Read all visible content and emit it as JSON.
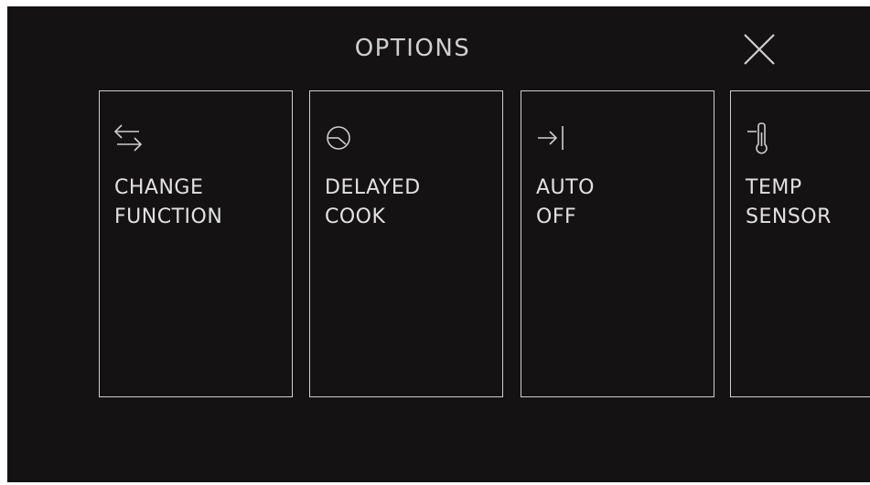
{
  "header": {
    "title": "OPTIONS",
    "close_icon": "close-icon"
  },
  "colors": {
    "background": "#141212",
    "foreground": "#cfcfcf"
  },
  "options": [
    {
      "line1": "CHANGE",
      "line2": "FUNCTION",
      "icon": "swap-arrows-icon"
    },
    {
      "line1": "DELAYED",
      "line2": "COOK",
      "icon": "clock-icon"
    },
    {
      "line1": "AUTO",
      "line2": "OFF",
      "icon": "arrow-to-bar-icon"
    },
    {
      "line1": "TEMP",
      "line2": "SENSOR",
      "icon": "thermometer-icon"
    }
  ]
}
